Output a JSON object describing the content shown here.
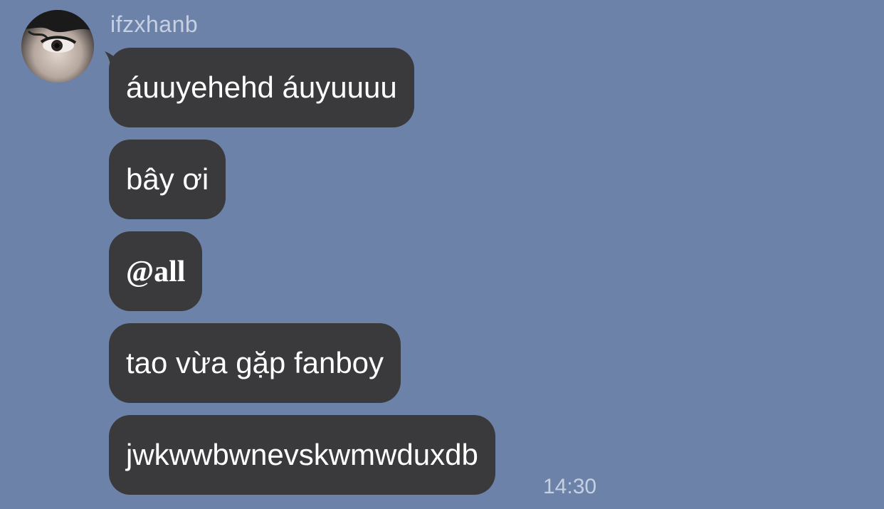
{
  "sender": {
    "name": "ifzxhanb"
  },
  "messages": [
    {
      "text": "áuuyehehd áuyuuuu"
    },
    {
      "text": "bây ơi"
    },
    {
      "text": "@all"
    },
    {
      "text": "tao vừa gặp fanboy"
    },
    {
      "text": "jwkwwbwnevskwmwduxdb"
    }
  ],
  "timestamp": "14:30",
  "colors": {
    "background": "#6c82a9",
    "bubble": "#3a3a3c",
    "bubble_text": "#ffffff",
    "meta_text": "#c6d0e3"
  }
}
